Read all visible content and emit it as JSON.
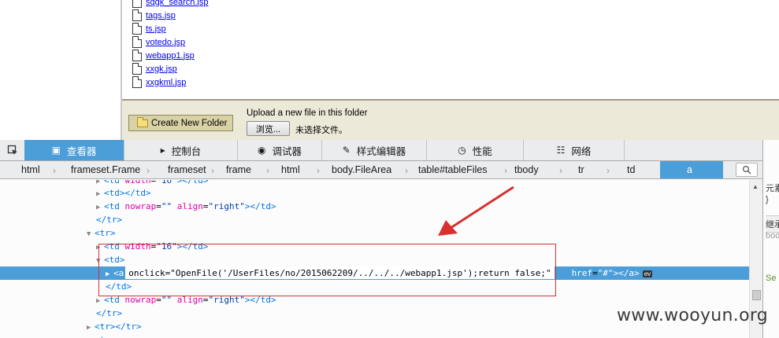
{
  "files": [
    "sqgk_search.jsp",
    "tags.jsp",
    "ts.jsp",
    "votedo.jsp",
    "webapp1.jsp",
    "xxgk.jsp",
    "xxgkml.jsp"
  ],
  "upload": {
    "create_folder_label": "Create New Folder",
    "upload_label": "Upload a new file in this folder",
    "browse_label": "浏览...",
    "no_file_label": "未选择文件。"
  },
  "toolbar": {
    "tabs": [
      {
        "icon": "inspector-icon",
        "label": "查看器",
        "active": true
      },
      {
        "icon": "console-icon",
        "label": "控制台",
        "active": false
      },
      {
        "icon": "debugger-icon",
        "label": "调试器",
        "active": false
      },
      {
        "icon": "style-editor-icon",
        "label": "样式编辑器",
        "active": false
      },
      {
        "icon": "performance-icon",
        "label": "性能",
        "active": false
      },
      {
        "icon": "network-icon",
        "label": "网络",
        "active": false
      }
    ]
  },
  "breadcrumb": [
    "html",
    "frameset.Frame",
    "frameset",
    "frame",
    "html",
    "body.FileArea",
    "table#tableFiles",
    "tbody",
    "tr",
    "td",
    "a"
  ],
  "markup": {
    "line_td_width": {
      "tag_open": "<td",
      "attr": "width",
      "val": "\"16\"",
      "close": "></td>"
    },
    "line_td_empty": "<td></td>",
    "line_td_nowrap": {
      "tag_open": "<td",
      "attr1": "nowrap",
      "val1": "\"\"",
      "attr2": "align",
      "val2": "\"right\"",
      "close": "></td>"
    },
    "line_tr_close": "</tr>",
    "line_tr_open": "<tr>",
    "line_td_open": "<td>",
    "selected": {
      "tag_open": "<a",
      "onclick": "onclick=\"OpenFile('/UserFiles/no/2015062209/../../../webapp1.jsp');return false;\"",
      "href_attr": "href",
      "href_val": "\"#\"",
      "close": "></a>",
      "badge": "ev"
    },
    "line_td_close": "</td>",
    "line_tr_empty": "<tr></tr>"
  },
  "sidepanel": [
    "元素",
    "}",
    "继承",
    "body",
    "Se"
  ],
  "watermark": "www.wooyun.org",
  "colors": {
    "accent": "#4c9ed9",
    "annotation": "#d93030"
  }
}
